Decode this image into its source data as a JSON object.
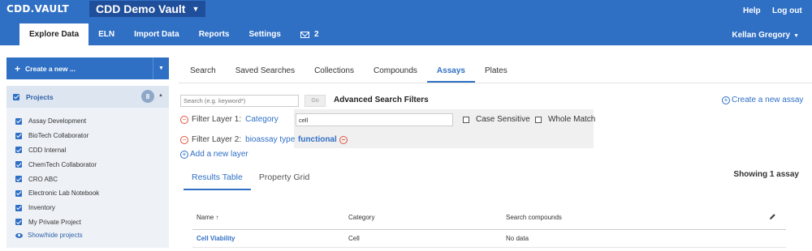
{
  "header": {
    "logo": "CDD.VAULT",
    "vault_name": "CDD Demo Vault",
    "help": "Help",
    "logout": "Log out",
    "user": "Kellan Gregory"
  },
  "nav": {
    "items": [
      {
        "label": "Explore Data",
        "active": true
      },
      {
        "label": "ELN"
      },
      {
        "label": "Import Data"
      },
      {
        "label": "Reports"
      },
      {
        "label": "Settings"
      }
    ],
    "messages_count": "2"
  },
  "sidebar": {
    "create_label": "Create a new ...",
    "projects_label": "Projects",
    "projects_count": "8",
    "projects": [
      "Assay Development",
      "BioTech Collaborator",
      "CDD Internal",
      "ChemTech Collaborator",
      "CRO ABC",
      "Electronic Lab Notebook",
      "Inventory",
      "My Private Project"
    ],
    "show_hide": "Show/hide projects"
  },
  "tabs": [
    "Search",
    "Saved Searches",
    "Collections",
    "Compounds",
    "Assays",
    "Plates"
  ],
  "active_tab": "Assays",
  "search": {
    "placeholder": "Search (e.g. keyword*)",
    "go": "Go",
    "advanced": "Advanced Search Filters",
    "create_assay": "Create a new assay"
  },
  "filters": {
    "layer1_label": "Filter Layer 1:",
    "layer1_field": "Category",
    "layer1_value": "cell",
    "case_sensitive": "Case Sensitive",
    "whole_match": "Whole Match",
    "layer2_label": "Filter Layer 2:",
    "layer2_field": "bioassay type",
    "layer2_value": "functional",
    "add_layer": "Add a new layer"
  },
  "results": {
    "tabs": [
      "Results Table",
      "Property Grid"
    ],
    "showing": "Showing 1 assay",
    "columns": [
      "Name",
      "Category",
      "Search compounds"
    ],
    "sort_indicator": "↑",
    "rows": [
      {
        "name": "Cell Viability",
        "category": "Cell",
        "search_compounds": "No data"
      }
    ]
  },
  "colors": {
    "brand_blue": "#2f6fc4",
    "danger": "#e0533d"
  }
}
